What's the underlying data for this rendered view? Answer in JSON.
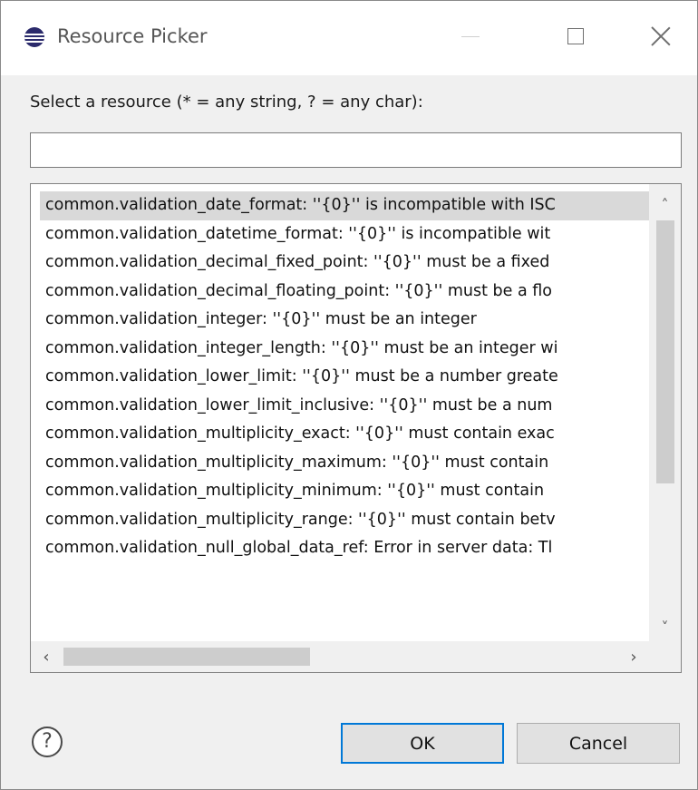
{
  "window": {
    "title": "Resource Picker",
    "controls": {
      "minimize": "minimize",
      "maximize": "maximize",
      "close": "close"
    }
  },
  "prompt": "Select a resource (* = any string, ? = any char):",
  "filter": {
    "value": "",
    "placeholder": ""
  },
  "resources": {
    "selected_index": 0,
    "items": [
      "common.validation_date_format: ''{0}'' is incompatible with ISC",
      "common.validation_datetime_format: ''{0}'' is incompatible wit",
      "common.validation_decimal_fixed_point: ''{0}'' must be a fixed",
      "common.validation_decimal_floating_point: ''{0}'' must be a flo",
      "common.validation_integer: ''{0}'' must be an integer",
      "common.validation_integer_length: ''{0}'' must be an integer wi",
      "common.validation_lower_limit: ''{0}'' must be a number greate",
      "common.validation_lower_limit_inclusive: ''{0}'' must be a num",
      "common.validation_multiplicity_exact: ''{0}'' must contain exac",
      "common.validation_multiplicity_maximum: ''{0}'' must contain",
      "common.validation_multiplicity_minimum: ''{0}'' must contain",
      "common.validation_multiplicity_range: ''{0}'' must contain betv",
      "common.validation_null_global_data_ref: Error in server data: Tl"
    ]
  },
  "buttons": {
    "help": "?",
    "ok": "OK",
    "cancel": "Cancel"
  },
  "colors": {
    "selected_row": "#d9d9d9",
    "default_button_border": "#0078d7",
    "app_icon": "#2b2a6b"
  },
  "icons": {
    "app": "eclipse-icon",
    "help": "help-icon",
    "scroll_up": "chevron-up-icon",
    "scroll_down": "chevron-down-icon",
    "scroll_left": "chevron-left-icon",
    "scroll_right": "chevron-right-icon"
  }
}
